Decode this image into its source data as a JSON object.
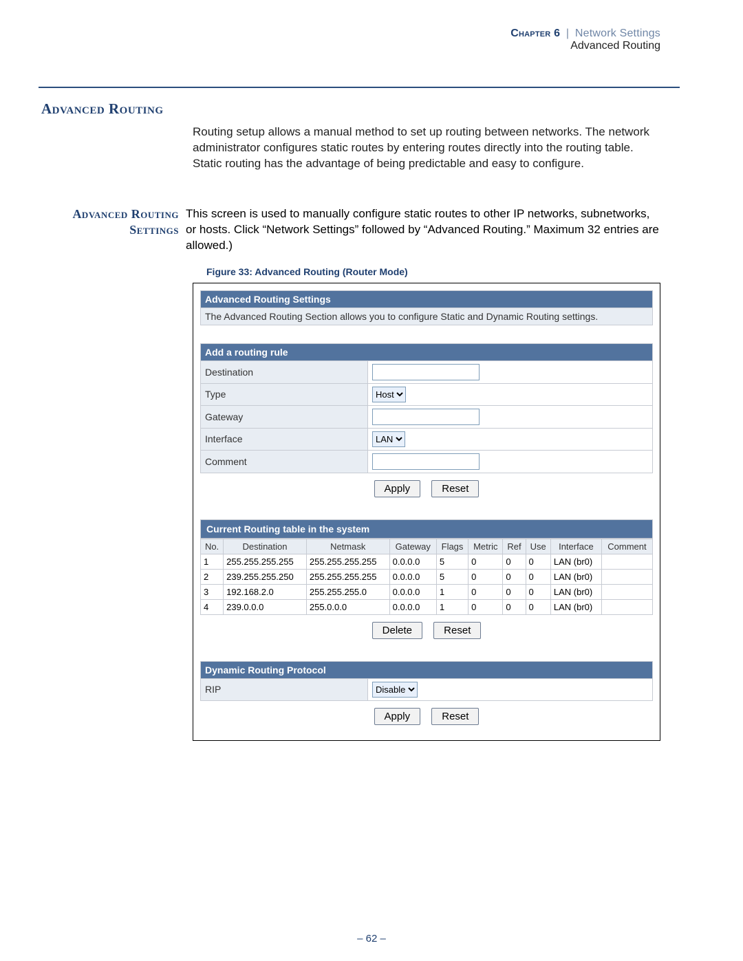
{
  "header": {
    "chapter_label": "Chapter 6",
    "sep": "|",
    "section": "Network Settings",
    "subsection": "Advanced Routing"
  },
  "sec_title": "Advanced Routing",
  "intro_para": "Routing setup allows a manual method to set up routing between networks. The network administrator configures static routes by entering routes directly into the routing table. Static routing has the advantage of being predictable and easy to configure.",
  "side_label_line1": "Advanced Routing",
  "side_label_line2": "Settings",
  "side_body": "This screen is used to manually configure static routes to other IP networks, subnetworks, or hosts. Click “Network Settings” followed by “Advanced Routing.” Maximum 32 entries are allowed.)",
  "fig_caption": "Figure 33:  Advanced Routing (Router Mode)",
  "panel1": {
    "title": "Advanced Routing Settings",
    "desc": "The Advanced Routing Section allows you to configure Static and Dynamic Routing settings."
  },
  "add_rule": {
    "title": "Add a routing rule",
    "labels": {
      "destination": "Destination",
      "type": "Type",
      "gateway": "Gateway",
      "interface": "Interface",
      "comment": "Comment"
    },
    "type_value": "Host",
    "interface_value": "LAN"
  },
  "buttons": {
    "apply": "Apply",
    "reset": "Reset",
    "delete": "Delete"
  },
  "routing_table": {
    "title": "Current Routing table in the system",
    "headers": [
      "No.",
      "Destination",
      "Netmask",
      "Gateway",
      "Flags",
      "Metric",
      "Ref",
      "Use",
      "Interface",
      "Comment"
    ],
    "rows": [
      {
        "no": "1",
        "destination": "255.255.255.255",
        "netmask": "255.255.255.255",
        "gateway": "0.0.0.0",
        "flags": "5",
        "metric": "0",
        "ref": "0",
        "use": "0",
        "interface": "LAN (br0)",
        "comment": ""
      },
      {
        "no": "2",
        "destination": "239.255.255.250",
        "netmask": "255.255.255.255",
        "gateway": "0.0.0.0",
        "flags": "5",
        "metric": "0",
        "ref": "0",
        "use": "0",
        "interface": "LAN (br0)",
        "comment": ""
      },
      {
        "no": "3",
        "destination": "192.168.2.0",
        "netmask": "255.255.255.0",
        "gateway": "0.0.0.0",
        "flags": "1",
        "metric": "0",
        "ref": "0",
        "use": "0",
        "interface": "LAN (br0)",
        "comment": ""
      },
      {
        "no": "4",
        "destination": "239.0.0.0",
        "netmask": "255.0.0.0",
        "gateway": "0.0.0.0",
        "flags": "1",
        "metric": "0",
        "ref": "0",
        "use": "0",
        "interface": "LAN (br0)",
        "comment": ""
      }
    ]
  },
  "dynamic": {
    "title": "Dynamic Routing Protocol",
    "label": "RIP",
    "value": "Disable"
  },
  "page_number": "–  62  –"
}
